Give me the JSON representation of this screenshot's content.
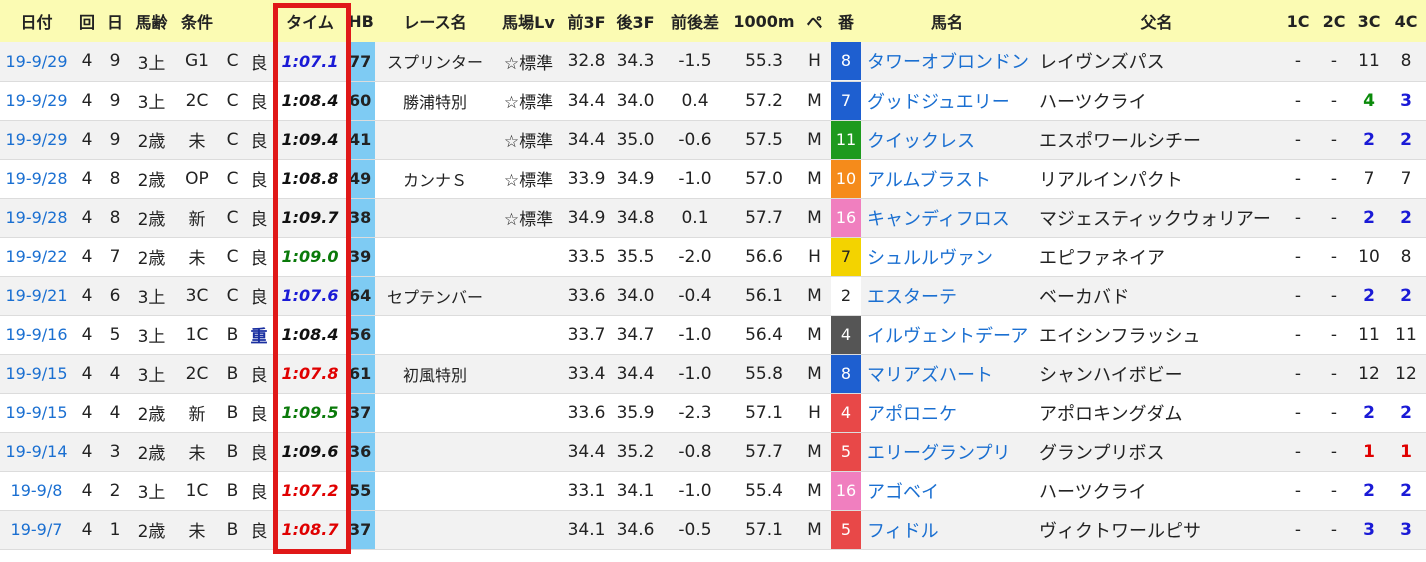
{
  "headers": [
    "日付",
    "回",
    "日",
    "馬齢",
    "条件",
    "",
    "",
    "タイム",
    "HB",
    "レース名",
    "馬場Lv",
    "前3F",
    "後3F",
    "前後差",
    "1000m",
    "ペ",
    "番",
    "馬名",
    "父名",
    "1C",
    "2C",
    "3C",
    "4C"
  ],
  "colors": {
    "header_bg": "#fbfbb3",
    "hb_bg": "#7ecbf3",
    "highlight_border": "#e01818",
    "link": "#1a6fd1"
  },
  "rows": [
    {
      "date": "19-9/29",
      "kai": "4",
      "nichi": "9",
      "age": "3上",
      "cls": "G1",
      "course": "C",
      "ground": "良",
      "time": "1:07.1",
      "time_color": "blue",
      "hb": "77",
      "race": "スプリンター",
      "lv": "☆標準",
      "f3": "32.8",
      "l3": "34.3",
      "diff": "-1.5",
      "m1000": "55.3",
      "pace": "H",
      "no": "8",
      "no_color": "c4",
      "horse": "タワーオブロンドン",
      "sire": "レイヴンズパス",
      "c1": "-",
      "c2": "-",
      "c3": "11",
      "c4": "8",
      "c3_color": "",
      "c4_color": ""
    },
    {
      "date": "19-9/29",
      "kai": "4",
      "nichi": "9",
      "age": "3上",
      "cls": "2C",
      "course": "C",
      "ground": "良",
      "time": "1:08.4",
      "time_color": "black",
      "hb": "60",
      "race": "勝浦特別",
      "lv": "☆標準",
      "f3": "34.4",
      "l3": "34.0",
      "diff": "0.4",
      "m1000": "57.2",
      "pace": "M",
      "no": "7",
      "no_color": "c4",
      "horse": "グッドジュエリー",
      "sire": "ハーツクライ",
      "c1": "-",
      "c2": "-",
      "c3": "4",
      "c4": "3",
      "c3_color": "green",
      "c4_color": "blue"
    },
    {
      "date": "19-9/29",
      "kai": "4",
      "nichi": "9",
      "age": "2歳",
      "cls": "未",
      "course": "C",
      "ground": "良",
      "time": "1:09.4",
      "time_color": "black",
      "hb": "41",
      "race": "",
      "lv": "☆標準",
      "f3": "34.4",
      "l3": "35.0",
      "diff": "-0.6",
      "m1000": "57.5",
      "pace": "M",
      "no": "11",
      "no_color": "c6",
      "horse": "クイックレス",
      "sire": "エスポワールシチー",
      "c1": "-",
      "c2": "-",
      "c3": "2",
      "c4": "2",
      "c3_color": "blue",
      "c4_color": "blue"
    },
    {
      "date": "19-9/28",
      "kai": "4",
      "nichi": "8",
      "age": "2歳",
      "cls": "OP",
      "course": "C",
      "ground": "良",
      "time": "1:08.8",
      "time_color": "black",
      "hb": "49",
      "race": "カンナＳ",
      "lv": "☆標準",
      "f3": "33.9",
      "l3": "34.9",
      "diff": "-1.0",
      "m1000": "57.0",
      "pace": "M",
      "no": "10",
      "no_color": "c7",
      "horse": "アルムブラスト",
      "sire": "リアルインパクト",
      "c1": "-",
      "c2": "-",
      "c3": "7",
      "c4": "7",
      "c3_color": "",
      "c4_color": ""
    },
    {
      "date": "19-9/28",
      "kai": "4",
      "nichi": "8",
      "age": "2歳",
      "cls": "新",
      "course": "C",
      "ground": "良",
      "time": "1:09.7",
      "time_color": "black",
      "hb": "38",
      "race": "",
      "lv": "☆標準",
      "f3": "34.9",
      "l3": "34.8",
      "diff": "0.1",
      "m1000": "57.7",
      "pace": "M",
      "no": "16",
      "no_color": "c8",
      "horse": "キャンディフロス",
      "sire": "マジェスティックウォリアー",
      "c1": "-",
      "c2": "-",
      "c3": "2",
      "c4": "2",
      "c3_color": "blue",
      "c4_color": "blue"
    },
    {
      "date": "19-9/22",
      "kai": "4",
      "nichi": "7",
      "age": "2歳",
      "cls": "未",
      "course": "C",
      "ground": "良",
      "time": "1:09.0",
      "time_color": "green",
      "hb": "39",
      "race": "",
      "lv": "",
      "f3": "33.5",
      "l3": "35.5",
      "diff": "-2.0",
      "m1000": "56.6",
      "pace": "H",
      "no": "7",
      "no_color": "c5",
      "horse": "シュルルヴァン",
      "sire": "エピファネイア",
      "c1": "-",
      "c2": "-",
      "c3": "10",
      "c4": "8",
      "c3_color": "",
      "c4_color": ""
    },
    {
      "date": "19-9/21",
      "kai": "4",
      "nichi": "6",
      "age": "3上",
      "cls": "3C",
      "course": "C",
      "ground": "良",
      "time": "1:07.6",
      "time_color": "blue",
      "hb": "64",
      "race": "セプテンバー",
      "lv": "",
      "f3": "33.6",
      "l3": "34.0",
      "diff": "-0.4",
      "m1000": "56.1",
      "pace": "M",
      "no": "2",
      "no_color": "c1",
      "horse": "エスターテ",
      "sire": "ベーカバド",
      "c1": "-",
      "c2": "-",
      "c3": "2",
      "c4": "2",
      "c3_color": "blue",
      "c4_color": "blue"
    },
    {
      "date": "19-9/16",
      "kai": "4",
      "nichi": "5",
      "age": "3上",
      "cls": "1C",
      "course": "B",
      "ground": "重",
      "time": "1:08.4",
      "time_color": "black",
      "hb": "56",
      "race": "",
      "lv": "",
      "f3": "33.7",
      "l3": "34.7",
      "diff": "-1.0",
      "m1000": "56.4",
      "pace": "M",
      "no": "4",
      "no_color": "c9",
      "horse": "イルヴェントデーア",
      "sire": "エイシンフラッシュ",
      "c1": "-",
      "c2": "-",
      "c3": "11",
      "c4": "11",
      "c3_color": "",
      "c4_color": ""
    },
    {
      "date": "19-9/15",
      "kai": "4",
      "nichi": "4",
      "age": "3上",
      "cls": "2C",
      "course": "B",
      "ground": "良",
      "time": "1:07.8",
      "time_color": "red",
      "hb": "61",
      "race": "初風特別",
      "lv": "",
      "f3": "33.4",
      "l3": "34.4",
      "diff": "-1.0",
      "m1000": "55.8",
      "pace": "M",
      "no": "8",
      "no_color": "c4",
      "horse": "マリアズハート",
      "sire": "シャンハイボビー",
      "c1": "-",
      "c2": "-",
      "c3": "12",
      "c4": "12",
      "c3_color": "",
      "c4_color": ""
    },
    {
      "date": "19-9/15",
      "kai": "4",
      "nichi": "4",
      "age": "2歳",
      "cls": "新",
      "course": "B",
      "ground": "良",
      "time": "1:09.5",
      "time_color": "green",
      "hb": "37",
      "race": "",
      "lv": "",
      "f3": "33.6",
      "l3": "35.9",
      "diff": "-2.3",
      "m1000": "57.1",
      "pace": "H",
      "no": "4",
      "no_color": "c3",
      "horse": "アポロニケ",
      "sire": "アポロキングダム",
      "c1": "-",
      "c2": "-",
      "c3": "2",
      "c4": "2",
      "c3_color": "blue",
      "c4_color": "blue"
    },
    {
      "date": "19-9/14",
      "kai": "4",
      "nichi": "3",
      "age": "2歳",
      "cls": "未",
      "course": "B",
      "ground": "良",
      "time": "1:09.6",
      "time_color": "black",
      "hb": "36",
      "race": "",
      "lv": "",
      "f3": "34.4",
      "l3": "35.2",
      "diff": "-0.8",
      "m1000": "57.7",
      "pace": "M",
      "no": "5",
      "no_color": "c3",
      "horse": "エリーグランプリ",
      "sire": "グランプリボス",
      "c1": "-",
      "c2": "-",
      "c3": "1",
      "c4": "1",
      "c3_color": "red",
      "c4_color": "red"
    },
    {
      "date": "19-9/8",
      "kai": "4",
      "nichi": "2",
      "age": "3上",
      "cls": "1C",
      "course": "B",
      "ground": "良",
      "time": "1:07.2",
      "time_color": "red",
      "hb": "55",
      "race": "",
      "lv": "",
      "f3": "33.1",
      "l3": "34.1",
      "diff": "-1.0",
      "m1000": "55.4",
      "pace": "M",
      "no": "16",
      "no_color": "c8",
      "horse": "アゴベイ",
      "sire": "ハーツクライ",
      "c1": "-",
      "c2": "-",
      "c3": "2",
      "c4": "2",
      "c3_color": "blue",
      "c4_color": "blue"
    },
    {
      "date": "19-9/7",
      "kai": "4",
      "nichi": "1",
      "age": "2歳",
      "cls": "未",
      "course": "B",
      "ground": "良",
      "time": "1:08.7",
      "time_color": "red",
      "hb": "37",
      "race": "",
      "lv": "",
      "f3": "34.1",
      "l3": "34.6",
      "diff": "-0.5",
      "m1000": "57.1",
      "pace": "M",
      "no": "5",
      "no_color": "c3",
      "horse": "フィドル",
      "sire": "ヴィクトワールピサ",
      "c1": "-",
      "c2": "-",
      "c3": "3",
      "c4": "3",
      "c3_color": "blue",
      "c4_color": "blue"
    }
  ]
}
